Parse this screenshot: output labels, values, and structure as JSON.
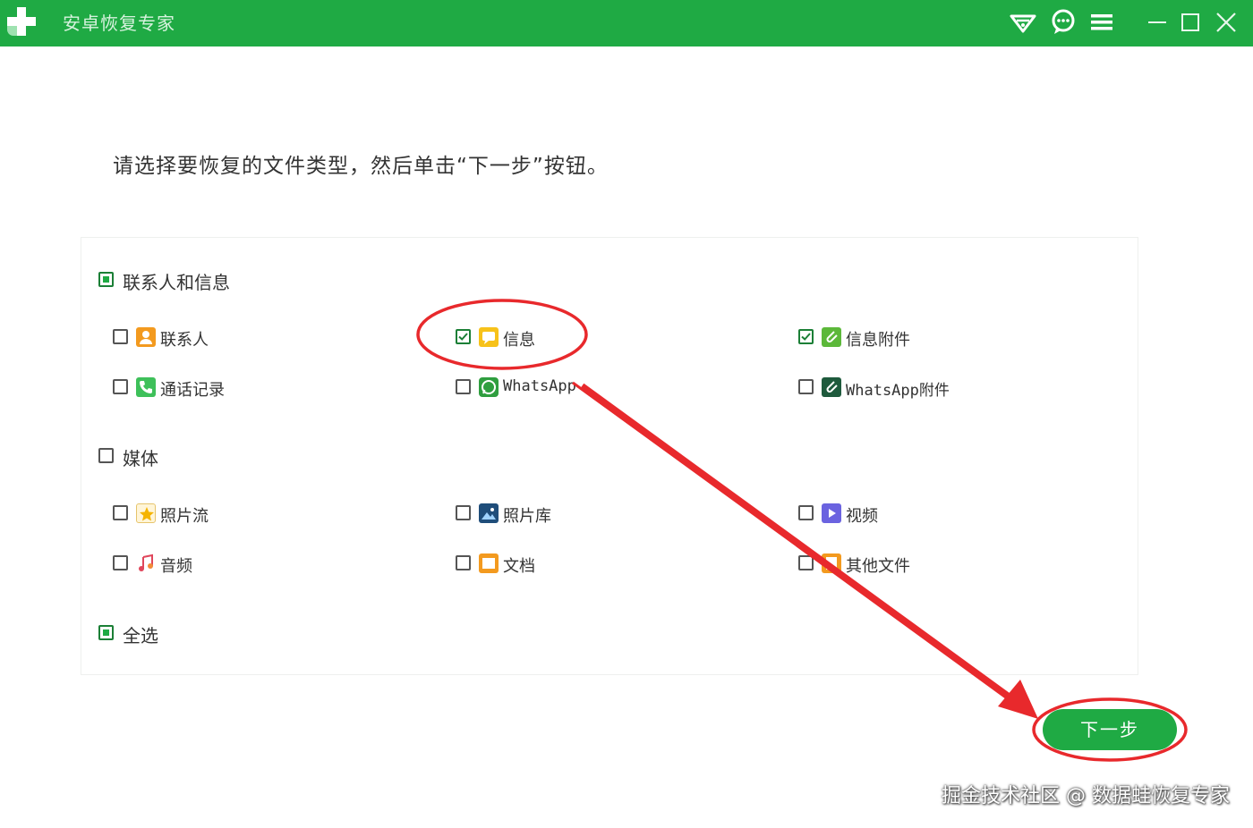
{
  "window": {
    "title": "安卓恢复专家",
    "icons": [
      "logo-icon",
      "wifi-icon",
      "chat-icon",
      "menu-icon",
      "minimize-icon",
      "maximize-icon",
      "close-icon"
    ]
  },
  "instruction": "请选择要恢复的文件类型，然后单击“下一步”按钮。",
  "groups": {
    "contacts_messages": {
      "label": "联系人和信息",
      "state": "partial",
      "items": [
        {
          "label": "联系人",
          "checked": false,
          "icon": "contact-icon"
        },
        {
          "label": "信息",
          "checked": true,
          "icon": "message-icon"
        },
        {
          "label": "信息附件",
          "checked": true,
          "icon": "attachment-icon"
        },
        {
          "label": "通话记录",
          "checked": false,
          "icon": "phone-icon"
        },
        {
          "label": "WhatsApp",
          "checked": false,
          "icon": "whatsapp-icon"
        },
        {
          "label": "WhatsApp附件",
          "checked": false,
          "icon": "whatsapp-attachment-icon"
        }
      ]
    },
    "media": {
      "label": "媒体",
      "state": "unchecked",
      "items": [
        {
          "label": "照片流",
          "checked": false,
          "icon": "photo-stream-icon"
        },
        {
          "label": "照片库",
          "checked": false,
          "icon": "photo-library-icon"
        },
        {
          "label": "视频",
          "checked": false,
          "icon": "video-icon"
        },
        {
          "label": "音频",
          "checked": false,
          "icon": "audio-icon"
        },
        {
          "label": "文档",
          "checked": false,
          "icon": "document-icon"
        },
        {
          "label": "其他文件",
          "checked": false,
          "icon": "other-files-icon"
        }
      ]
    }
  },
  "select_all": {
    "label": "全选",
    "state": "partial"
  },
  "next_button": "下一步",
  "watermark": "掘金技术社区 @ 数据蛙恢复专家",
  "colors": {
    "brand_green": "#1faa44",
    "annotation_red": "#e8292c"
  }
}
